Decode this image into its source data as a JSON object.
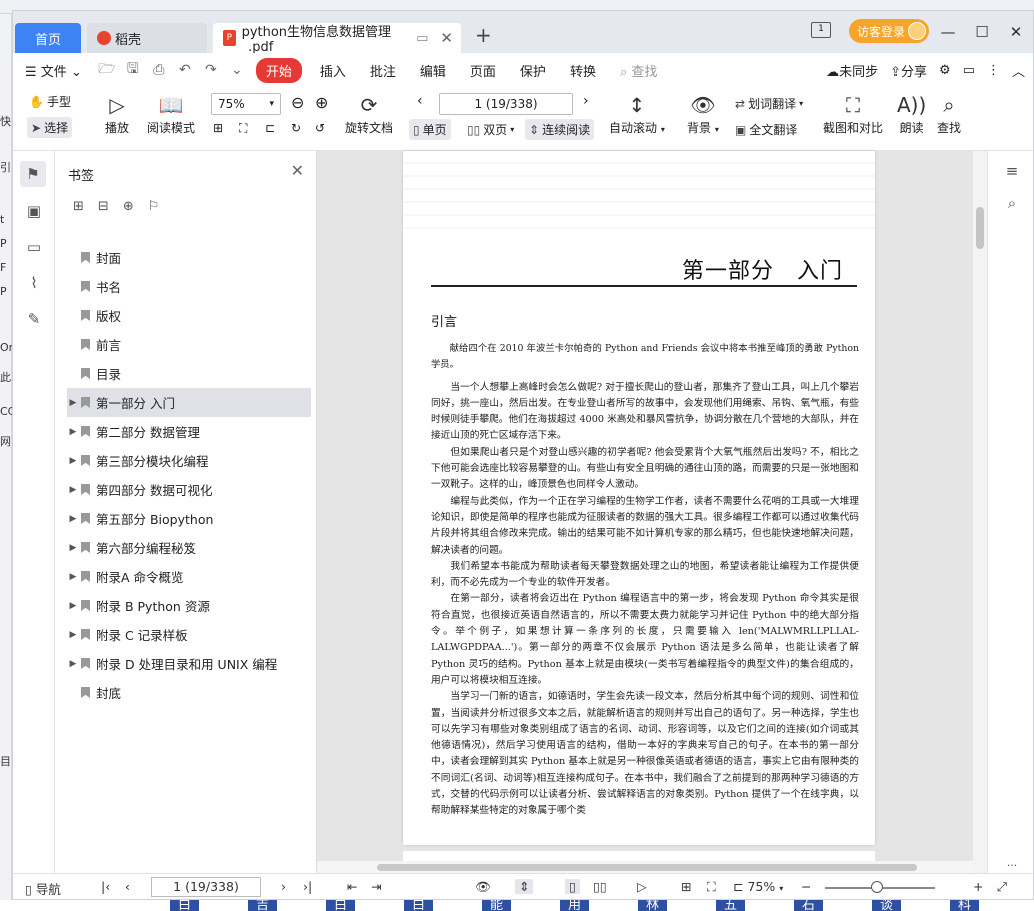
{
  "window": {
    "tabs": [
      {
        "label": "首页"
      },
      {
        "label": "稻壳"
      },
      {
        "label": "python生物信息数据管理_.pdf"
      }
    ],
    "new_tab": "+",
    "visitor_login": "访客登录",
    "reader_icon_label": "1"
  },
  "menu": {
    "file": "文件",
    "items": [
      "开始",
      "插入",
      "批注",
      "编辑",
      "页面",
      "保护",
      "转换"
    ],
    "search": "查找",
    "unsynced": "未同步",
    "share": "分享"
  },
  "toolbar": {
    "hand": "手型",
    "select": "选择",
    "play": "播放",
    "read_mode": "阅读模式",
    "zoom": "75%",
    "rotate": "旋转文档",
    "page_indicator": "1 (19/338)",
    "single": "单页",
    "double": "双页",
    "continuous": "连续阅读",
    "auto_scroll": "自动滚动",
    "background": "背景",
    "word_translate": "划词翻译",
    "full_translate": "全文翻译",
    "screenshot": "截图和对比",
    "read_aloud": "朗读",
    "find": "查找"
  },
  "bookmarks": {
    "title": "书签",
    "items": [
      {
        "label": "封面",
        "expandable": false
      },
      {
        "label": "书名",
        "expandable": false
      },
      {
        "label": "版权",
        "expandable": false
      },
      {
        "label": "前言",
        "expandable": false
      },
      {
        "label": "目录",
        "expandable": false
      },
      {
        "label": "第一部分 入门",
        "expandable": true,
        "active": true
      },
      {
        "label": "第二部分 数据管理",
        "expandable": true
      },
      {
        "label": "第三部分模块化编程",
        "expandable": true
      },
      {
        "label": "第四部分 数据可视化",
        "expandable": true
      },
      {
        "label": "第五部分 Biopython",
        "expandable": true
      },
      {
        "label": "第六部分编程秘笈",
        "expandable": true
      },
      {
        "label": "附录A 命令概览",
        "expandable": true
      },
      {
        "label": "附录 B Python 资源",
        "expandable": true
      },
      {
        "label": "附录 C 记录样板",
        "expandable": true
      },
      {
        "label": "附录 D 处理目录和用 UNIX 编程",
        "expandable": true
      },
      {
        "label": "封底",
        "expandable": false
      }
    ]
  },
  "document": {
    "chapter_title": "第一部分　入门",
    "section_heading": "引言",
    "paragraphs": [
      "献给四个在 2010 年波兰卡尔帕奇的 Python and Friends 会议中将本书推至峰顶的勇敢 Python 学员。",
      "当一个人想攀上高峰时会怎么做呢? 对于擅长爬山的登山者，那集齐了登山工具，叫上几个攀岩同好，挑一座山，然后出发。在专业登山者所写的故事中，会发现他们用绳索、吊钩、氧气瓶，有些时候则徒手攀爬。他们在海拔超过 4000 米高处和暴风雪抗争，协调分散在几个营地的大部队，并在接近山顶的死亡区域存活下来。",
      "但如果爬山者只是个对登山感兴趣的初学者呢? 他会受累背个大氧气瓶然后出发吗? 不，相比之下他可能会选座比较容易攀登的山。有些山有安全且明确的通往山顶的路，而需要的只是一张地图和一双靴子。这样的山，峰顶景色也同样令人激动。",
      "编程与此类似，作为一个正在学习编程的生物学工作者，读者不需要什么花哨的工具或一大堆理论知识，即使是简单的程序也能成为征服读者的数据的强大工具。很多编程工作都可以通过收集代码片段并将其组合修改来完成。输出的结果可能不如计算机专家的那么精巧，但也能快速地解决问题，解决读者的问题。",
      "我们希望本书能成为帮助读者每天攀登数据处理之山的地图，希望读者能让编程为工作提供便利，而不必先成为一个专业的软件开发者。",
      "在第一部分，读者将会迈出在 Python 编程语言中的第一步，将会发现 Python 命令其实是很符合直觉，也很接近英语自然语言的，所以不需要太费力就能学习并记住 Python 中的绝大部分指令。举个例子，如果想计算一条序列的长度，只需要输入 len('MALWMRLLPLLAL-LALWGPDPAA...')。第一部分的两章不仅会展示 Python 语法是多么简单，也能让读者了解 Python 灵巧的结构。Python 基本上就是由模块(一类书写着编程指令的典型文件)的集合组成的，用户可以将模块相互连接。",
      "当学习一门新的语言，如德语时，学生会先读一段文本，然后分析其中每个词的规则、词性和位置，当阅读并分析过很多文本之后，就能解析语言的规则并写出自己的语句了。另一种选择，学生也可以先学习有哪些对象类别组成了语言的名词、动词、形容词等，以及它们之间的连接(如介词或其他德语情况)，然后学习使用语言的结构，借助一本好的字典来写自己的句子。在本书的第一部分中，读者会理解到其实 Python 基本上就是另一种很像英语或者德语的语言，事实上它由有限种类的不同词汇(名词、动词等)相互连接构成句子。在本书中，我们融合了之前提到的那两种学习德语的方式，交替的代码示例可以让读者分析、尝试解释语言的对象类别。Python 提供了一个在线字典，以帮助解释某些特定的对象属于哪个类"
    ]
  },
  "statusbar": {
    "nav": "导航",
    "page_indicator": "1 (19/338)",
    "zoom": "75%",
    "more": "..."
  },
  "desktop": {
    "left_strip_chars": [
      "快",
      "引",
      "t",
      "P",
      "F",
      "P",
      "Or",
      "此",
      "CC",
      "网",
      "目"
    ],
    "bottom_chars": [
      "白",
      "吉",
      "白",
      "白",
      "能",
      "用",
      "林",
      "五",
      "石",
      "谈",
      "科"
    ]
  }
}
